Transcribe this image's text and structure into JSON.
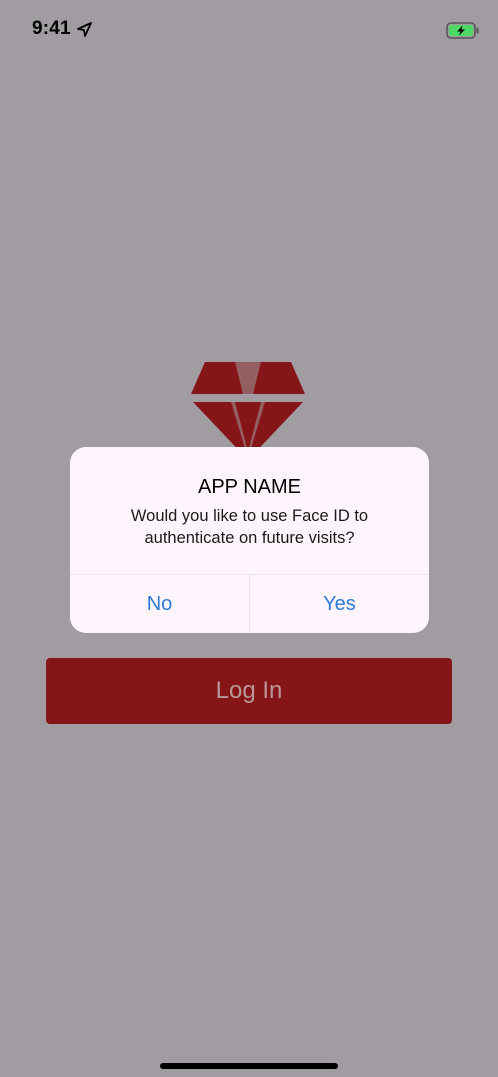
{
  "status_bar": {
    "time": "9:41",
    "location_icon": "location-arrow-icon",
    "battery_icon": "battery-charging-icon",
    "battery_color": "#4cd964"
  },
  "logo": {
    "icon": "diamond-icon",
    "color": "#861517"
  },
  "login_button": {
    "label": "Log In",
    "color": "#861517"
  },
  "alert": {
    "title": "APP NAME",
    "message": "Would you like to use Face ID to authenticate on future visits?",
    "no_label": "No",
    "yes_label": "Yes",
    "button_color": "#2a7bd6"
  },
  "colors": {
    "dimmed_background": "#a19ca1"
  }
}
